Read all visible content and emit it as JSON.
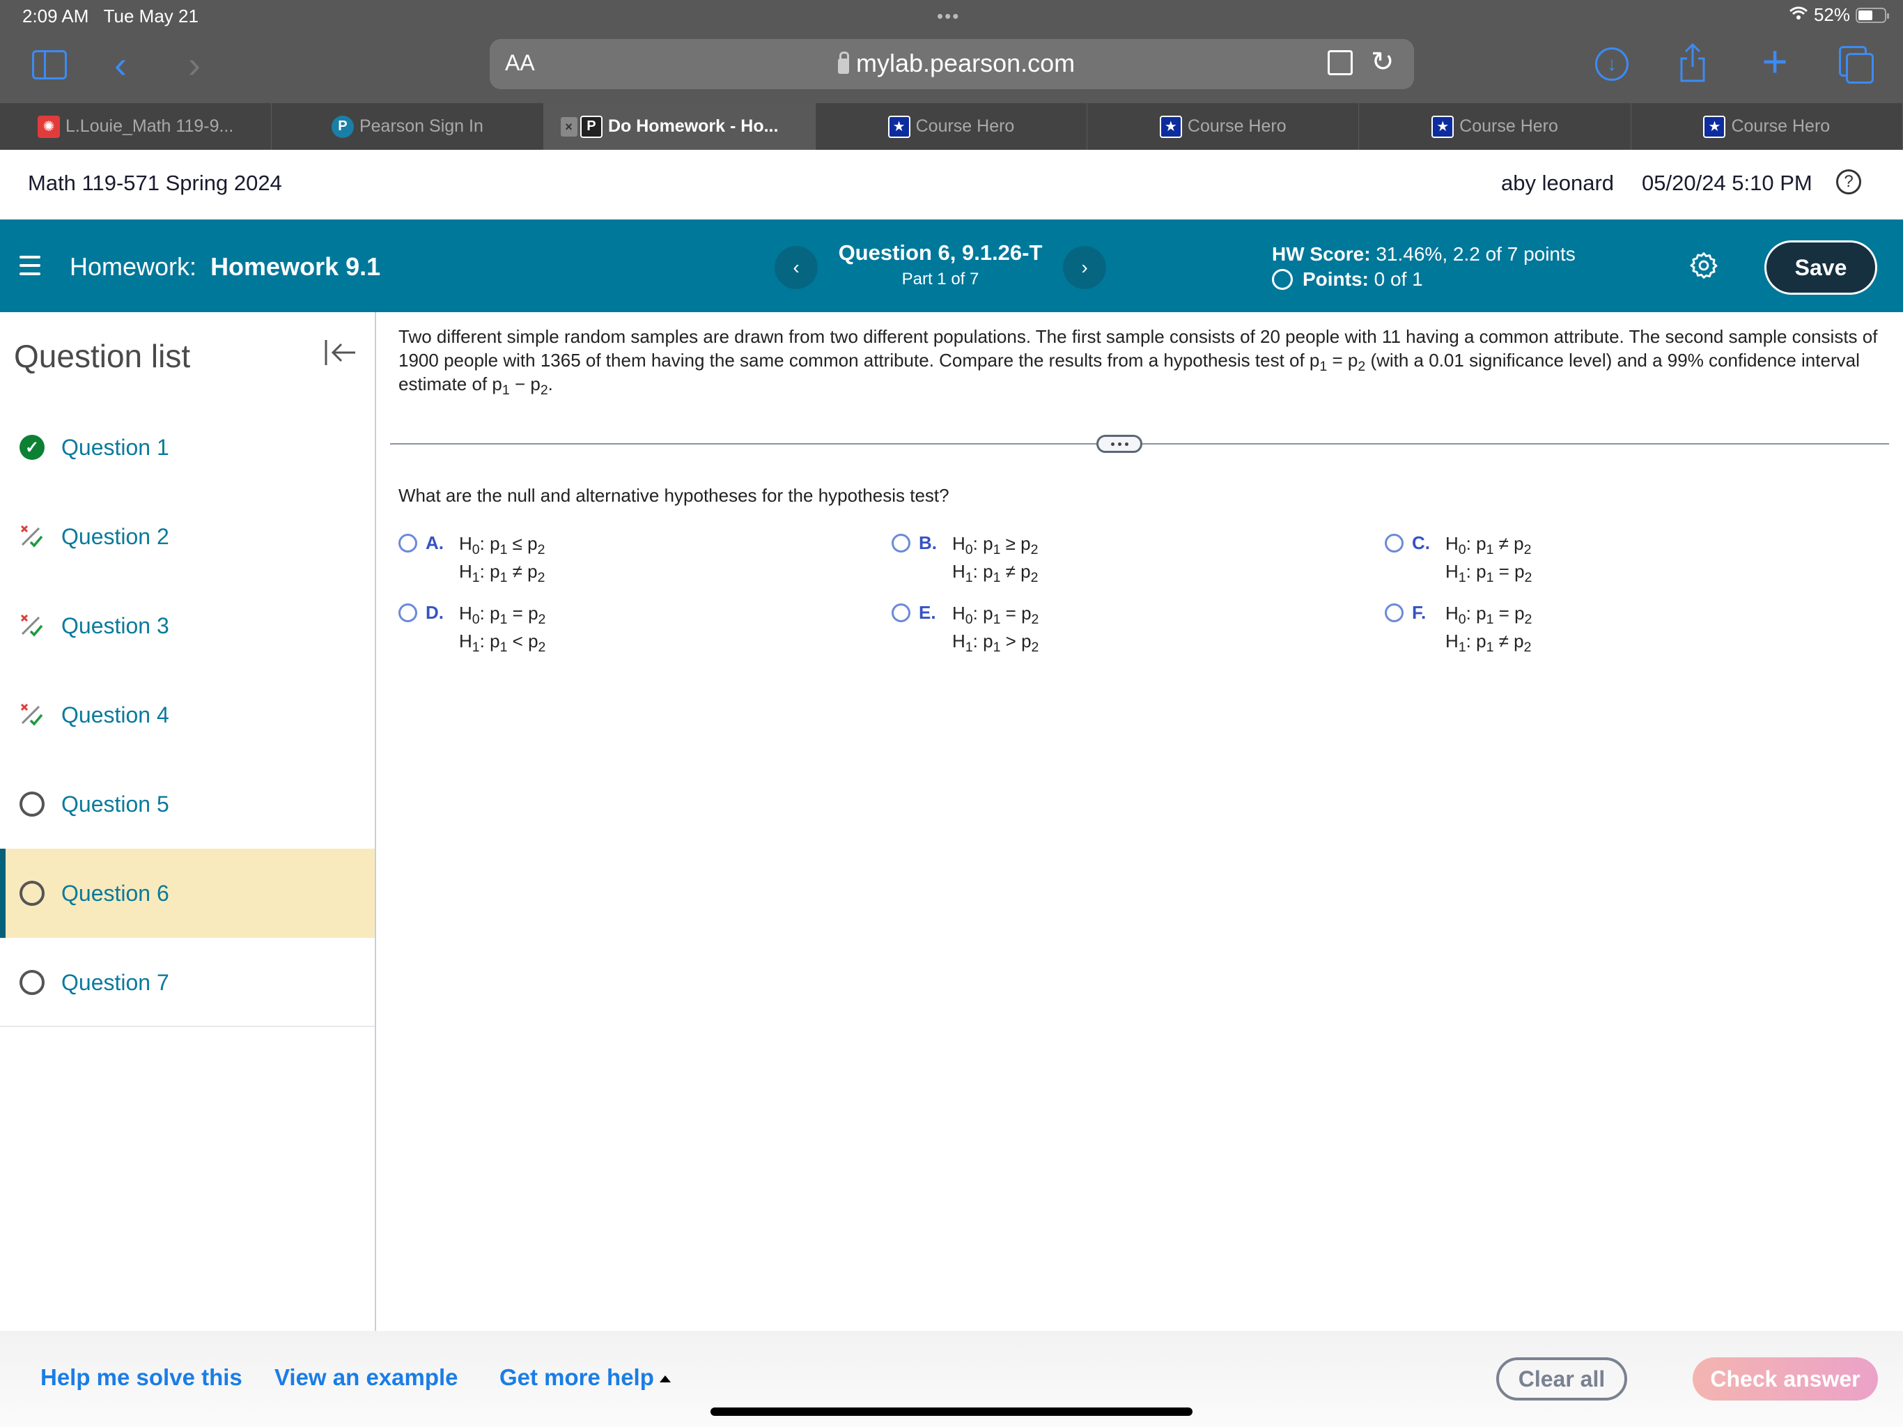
{
  "status_bar": {
    "time": "2:09 AM",
    "date": "Tue May 21",
    "battery": "52%"
  },
  "browser": {
    "aa_label": "AA",
    "url": "mylab.pearson.com",
    "tabs": [
      {
        "label": "L.Louie_Math 119-9...",
        "icon": "canvas-icon",
        "active": false
      },
      {
        "label": "Pearson Sign In",
        "icon": "pearson-icon",
        "active": false
      },
      {
        "label": "Do Homework - Ho...",
        "icon": "pearson-p-icon",
        "active": true
      },
      {
        "label": "Course Hero",
        "icon": "course-hero-icon",
        "active": false
      },
      {
        "label": "Course Hero",
        "icon": "course-hero-icon",
        "active": false
      },
      {
        "label": "Course Hero",
        "icon": "course-hero-icon",
        "active": false
      },
      {
        "label": "Course Hero",
        "icon": "course-hero-icon",
        "active": false
      }
    ]
  },
  "course_header": {
    "course_title": "Math 119-571 Spring 2024",
    "user_name": "aby leonard",
    "datetime": "05/20/24 5:10 PM",
    "help_glyph": "?"
  },
  "hw_bar": {
    "hw_prefix": "Homework:",
    "hw_name": "Homework 9.1",
    "question_title": "Question 6, 9.1.26-T",
    "part": "Part 1 of 7",
    "score_label": "HW Score:",
    "score_value": "31.46%, 2.2 of 7 points",
    "points_label": "Points:",
    "points_value": "0 of 1",
    "save_label": "Save",
    "prev_glyph": "‹",
    "next_glyph": "›",
    "colors": {
      "bar": "#00789a",
      "save_bg": "#17303f"
    }
  },
  "sidebar": {
    "title": "Question list",
    "items": [
      {
        "label": "Question 1",
        "status": "correct"
      },
      {
        "label": "Question 2",
        "status": "partial"
      },
      {
        "label": "Question 3",
        "status": "partial"
      },
      {
        "label": "Question 4",
        "status": "partial"
      },
      {
        "label": "Question 5",
        "status": "unanswered"
      },
      {
        "label": "Question 6",
        "status": "unanswered",
        "current": true
      },
      {
        "label": "Question 7",
        "status": "unanswered"
      }
    ]
  },
  "question": {
    "text_1": "Two different simple random samples are drawn from two different populations. The first sample consists of 20 people with 11 having a common attribute. The second sample consists of 1900 people with 1365 of them having the same common attribute. Compare the results from a hypothesis test of p",
    "text_2": " = p",
    "text_3": " (with a 0.01 significance level) and a 99% confidence interval estimate of p",
    "text_4": " − p",
    "text_5": ".",
    "sub_1": "1",
    "sub_2": "2",
    "prompt": "What are the null and alternative hypotheses for the hypothesis test?",
    "options": [
      {
        "letter": "A.",
        "h0_rel": "≤",
        "h1_rel": "≠"
      },
      {
        "letter": "B.",
        "h0_rel": "≥",
        "h1_rel": "≠"
      },
      {
        "letter": "C.",
        "h0_rel": "≠",
        "h1_rel": "="
      },
      {
        "letter": "D.",
        "h0_rel": "=",
        "h1_rel": "<"
      },
      {
        "letter": "E.",
        "h0_rel": "=",
        "h1_rel": ">"
      },
      {
        "letter": "F.",
        "h0_rel": "=",
        "h1_rel": "≠"
      }
    ],
    "hyp": {
      "H": "H",
      "p": "p",
      "s0": "0",
      "s1": "1",
      "s2": "2",
      "colon": ": "
    }
  },
  "footer": {
    "help_me_solve": "Help me solve this",
    "view_example": "View an example",
    "get_more_help": "Get more help",
    "clear_all": "Clear all",
    "check_answer": "Check answer"
  }
}
